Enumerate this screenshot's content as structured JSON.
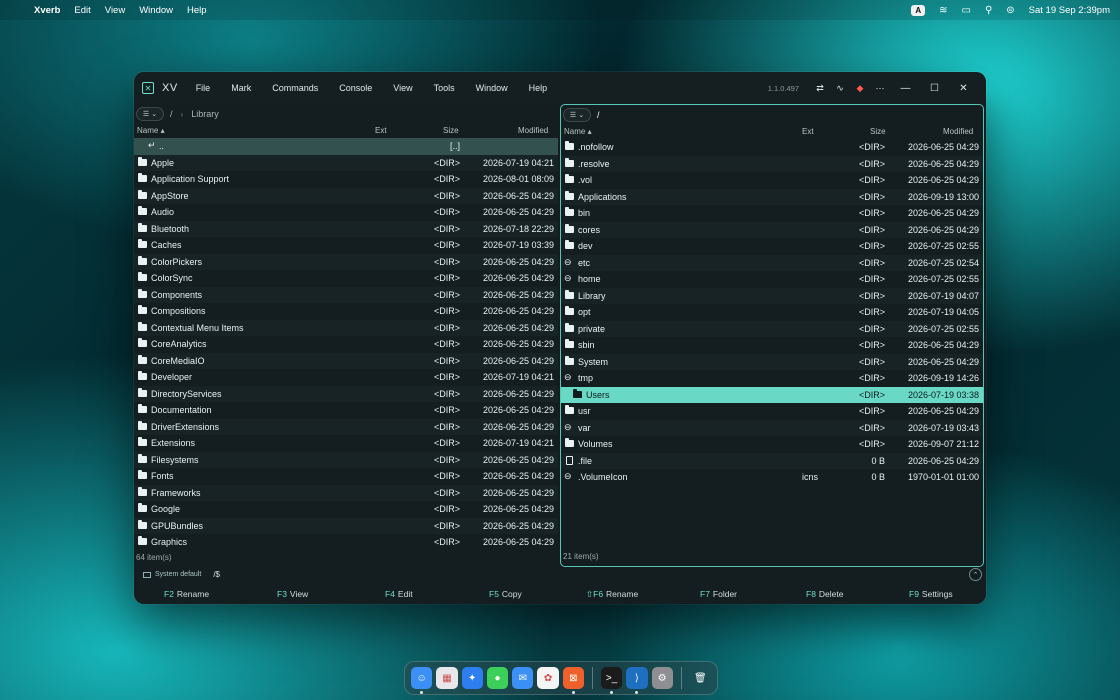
{
  "menubar": {
    "app_name": "Xverb",
    "items": [
      "Edit",
      "View",
      "Window",
      "Help"
    ],
    "keyboard_badge": "A",
    "clock": "Sat 19 Sep  2:39pm"
  },
  "window": {
    "short_name": "XV",
    "menus": [
      "File",
      "Mark",
      "Commands",
      "Console",
      "View",
      "Tools",
      "Window",
      "Help"
    ],
    "version": "1.1.0.497"
  },
  "left_pane": {
    "path_root": "/",
    "path_current": "Library",
    "columns": {
      "name": "Name ▴",
      "ext": "Ext",
      "size": "Size",
      "modified": "Modified"
    },
    "rows": [
      {
        "type": "updir",
        "name": "..",
        "ext": "",
        "size": "[..]",
        "modified": ""
      },
      {
        "type": "dir",
        "name": "Apple",
        "ext": "",
        "size": "<DIR>",
        "modified": "2026-07-19 04:21"
      },
      {
        "type": "dir",
        "name": "Application Support",
        "ext": "",
        "size": "<DIR>",
        "modified": "2026-08-01 08:09"
      },
      {
        "type": "dir",
        "name": "AppStore",
        "ext": "",
        "size": "<DIR>",
        "modified": "2026-06-25 04:29"
      },
      {
        "type": "dir",
        "name": "Audio",
        "ext": "",
        "size": "<DIR>",
        "modified": "2026-06-25 04:29"
      },
      {
        "type": "dir",
        "name": "Bluetooth",
        "ext": "",
        "size": "<DIR>",
        "modified": "2026-07-18 22:29"
      },
      {
        "type": "dir",
        "name": "Caches",
        "ext": "",
        "size": "<DIR>",
        "modified": "2026-07-19 03:39"
      },
      {
        "type": "dir",
        "name": "ColorPickers",
        "ext": "",
        "size": "<DIR>",
        "modified": "2026-06-25 04:29"
      },
      {
        "type": "dir",
        "name": "ColorSync",
        "ext": "",
        "size": "<DIR>",
        "modified": "2026-06-25 04:29"
      },
      {
        "type": "dir",
        "name": "Components",
        "ext": "",
        "size": "<DIR>",
        "modified": "2026-06-25 04:29"
      },
      {
        "type": "dir",
        "name": "Compositions",
        "ext": "",
        "size": "<DIR>",
        "modified": "2026-06-25 04:29"
      },
      {
        "type": "dir",
        "name": "Contextual Menu Items",
        "ext": "",
        "size": "<DIR>",
        "modified": "2026-06-25 04:29"
      },
      {
        "type": "dir",
        "name": "CoreAnalytics",
        "ext": "",
        "size": "<DIR>",
        "modified": "2026-06-25 04:29"
      },
      {
        "type": "dir",
        "name": "CoreMediaIO",
        "ext": "",
        "size": "<DIR>",
        "modified": "2026-06-25 04:29"
      },
      {
        "type": "dir",
        "name": "Developer",
        "ext": "",
        "size": "<DIR>",
        "modified": "2026-07-19 04:21"
      },
      {
        "type": "dir",
        "name": "DirectoryServices",
        "ext": "",
        "size": "<DIR>",
        "modified": "2026-06-25 04:29"
      },
      {
        "type": "dir",
        "name": "Documentation",
        "ext": "",
        "size": "<DIR>",
        "modified": "2026-06-25 04:29"
      },
      {
        "type": "dir",
        "name": "DriverExtensions",
        "ext": "",
        "size": "<DIR>",
        "modified": "2026-06-25 04:29"
      },
      {
        "type": "dir",
        "name": "Extensions",
        "ext": "",
        "size": "<DIR>",
        "modified": "2026-07-19 04:21"
      },
      {
        "type": "dir",
        "name": "Filesystems",
        "ext": "",
        "size": "<DIR>",
        "modified": "2026-06-25 04:29"
      },
      {
        "type": "dir",
        "name": "Fonts",
        "ext": "",
        "size": "<DIR>",
        "modified": "2026-06-25 04:29"
      },
      {
        "type": "dir",
        "name": "Frameworks",
        "ext": "",
        "size": "<DIR>",
        "modified": "2026-06-25 04:29"
      },
      {
        "type": "dir",
        "name": "Google",
        "ext": "",
        "size": "<DIR>",
        "modified": "2026-06-25 04:29"
      },
      {
        "type": "dir",
        "name": "GPUBundles",
        "ext": "",
        "size": "<DIR>",
        "modified": "2026-06-25 04:29"
      },
      {
        "type": "dir",
        "name": "Graphics",
        "ext": "",
        "size": "<DIR>",
        "modified": "2026-06-25 04:29"
      }
    ],
    "count": "64 item(s)"
  },
  "right_pane": {
    "path_root": "/",
    "columns": {
      "name": "Name ▴",
      "ext": "Ext",
      "size": "Size",
      "modified": "Modified"
    },
    "rows": [
      {
        "type": "dir",
        "name": ".nofollow",
        "ext": "",
        "size": "<DIR>",
        "modified": "2026-06-25 04:29"
      },
      {
        "type": "dir",
        "name": ".resolve",
        "ext": "",
        "size": "<DIR>",
        "modified": "2026-06-25 04:29"
      },
      {
        "type": "dir",
        "name": ".vol",
        "ext": "",
        "size": "<DIR>",
        "modified": "2026-06-25 04:29"
      },
      {
        "type": "dir",
        "name": "Applications",
        "ext": "",
        "size": "<DIR>",
        "modified": "2026-09-19 13:00"
      },
      {
        "type": "dir",
        "name": "bin",
        "ext": "",
        "size": "<DIR>",
        "modified": "2026-06-25 04:29"
      },
      {
        "type": "dir",
        "name": "cores",
        "ext": "",
        "size": "<DIR>",
        "modified": "2026-06-25 04:29"
      },
      {
        "type": "dir",
        "name": "dev",
        "ext": "",
        "size": "<DIR>",
        "modified": "2026-07-25 02:55"
      },
      {
        "type": "link",
        "name": "etc",
        "ext": "",
        "size": "<DIR>",
        "modified": "2026-07-25 02:54"
      },
      {
        "type": "link",
        "name": "home",
        "ext": "",
        "size": "<DIR>",
        "modified": "2026-07-25 02:55"
      },
      {
        "type": "dir",
        "name": "Library",
        "ext": "",
        "size": "<DIR>",
        "modified": "2026-07-19 04:07"
      },
      {
        "type": "dir",
        "name": "opt",
        "ext": "",
        "size": "<DIR>",
        "modified": "2026-07-19 04:05"
      },
      {
        "type": "dir",
        "name": "private",
        "ext": "",
        "size": "<DIR>",
        "modified": "2026-07-25 02:55"
      },
      {
        "type": "dir",
        "name": "sbin",
        "ext": "",
        "size": "<DIR>",
        "modified": "2026-06-25 04:29"
      },
      {
        "type": "dir",
        "name": "System",
        "ext": "",
        "size": "<DIR>",
        "modified": "2026-06-25 04:29"
      },
      {
        "type": "link",
        "name": "tmp",
        "ext": "",
        "size": "<DIR>",
        "modified": "2026-09-19 14:26"
      },
      {
        "type": "dir",
        "name": "Users",
        "ext": "",
        "size": "<DIR>",
        "modified": "2026-07-19 03:38",
        "selected": true
      },
      {
        "type": "dir",
        "name": "usr",
        "ext": "",
        "size": "<DIR>",
        "modified": "2026-06-25 04:29"
      },
      {
        "type": "link",
        "name": "var",
        "ext": "",
        "size": "<DIR>",
        "modified": "2026-07-19 03:43"
      },
      {
        "type": "dir",
        "name": "Volumes",
        "ext": "",
        "size": "<DIR>",
        "modified": "2026-09-07 21:12"
      },
      {
        "type": "file",
        "name": ".file",
        "ext": "",
        "size": "0 B",
        "modified": "2026-06-25 04:29"
      },
      {
        "type": "link",
        "name": ".VolumeIcon",
        "ext": "icns",
        "size": "0 B",
        "modified": "1970-01-01 01:00"
      }
    ],
    "count": "21 item(s)"
  },
  "cmdline": {
    "shell": "System default",
    "prompt": "/$"
  },
  "fkeys": [
    {
      "key": "F2",
      "label": "Rename"
    },
    {
      "key": "F3",
      "label": "View"
    },
    {
      "key": "F4",
      "label": "Edit"
    },
    {
      "key": "F5",
      "label": "Copy"
    },
    {
      "key": "⇧F6",
      "label": "Rename"
    },
    {
      "key": "F7",
      "label": "Folder"
    },
    {
      "key": "F8",
      "label": "Delete"
    },
    {
      "key": "F9",
      "label": "Settings"
    }
  ],
  "colors": {
    "accent": "#69d8c5",
    "window_bg": "#141d1f",
    "row_alt": "#182325"
  },
  "dock": [
    {
      "name": "finder-icon",
      "color": "#3b8ff5",
      "glyph": "☺",
      "running": true
    },
    {
      "name": "launchpad-icon",
      "color": "#e8e8ec",
      "glyph": "▦",
      "running": false
    },
    {
      "name": "safari-icon",
      "color": "#2f7ef0",
      "glyph": "✦",
      "running": false
    },
    {
      "name": "messages-icon",
      "color": "#3ccf5a",
      "glyph": "●",
      "running": false
    },
    {
      "name": "mail-icon",
      "color": "#3b8ff5",
      "glyph": "✉",
      "running": false
    },
    {
      "name": "photos-icon",
      "color": "#f5f5f5",
      "glyph": "✿",
      "running": false
    },
    {
      "name": "xverb-icon",
      "color": "#f0602a",
      "glyph": "⊠",
      "running": true
    },
    {
      "name": "terminal-icon",
      "color": "#1b1b1b",
      "glyph": ">_",
      "running": true
    },
    {
      "name": "vscode-icon",
      "color": "#1e6fc0",
      "glyph": "⟩",
      "running": true
    },
    {
      "name": "system-settings-icon",
      "color": "#8e8e93",
      "glyph": "⚙",
      "running": false
    },
    {
      "name": "trash-icon",
      "color": "transparent",
      "glyph": "🗑",
      "running": false
    }
  ]
}
